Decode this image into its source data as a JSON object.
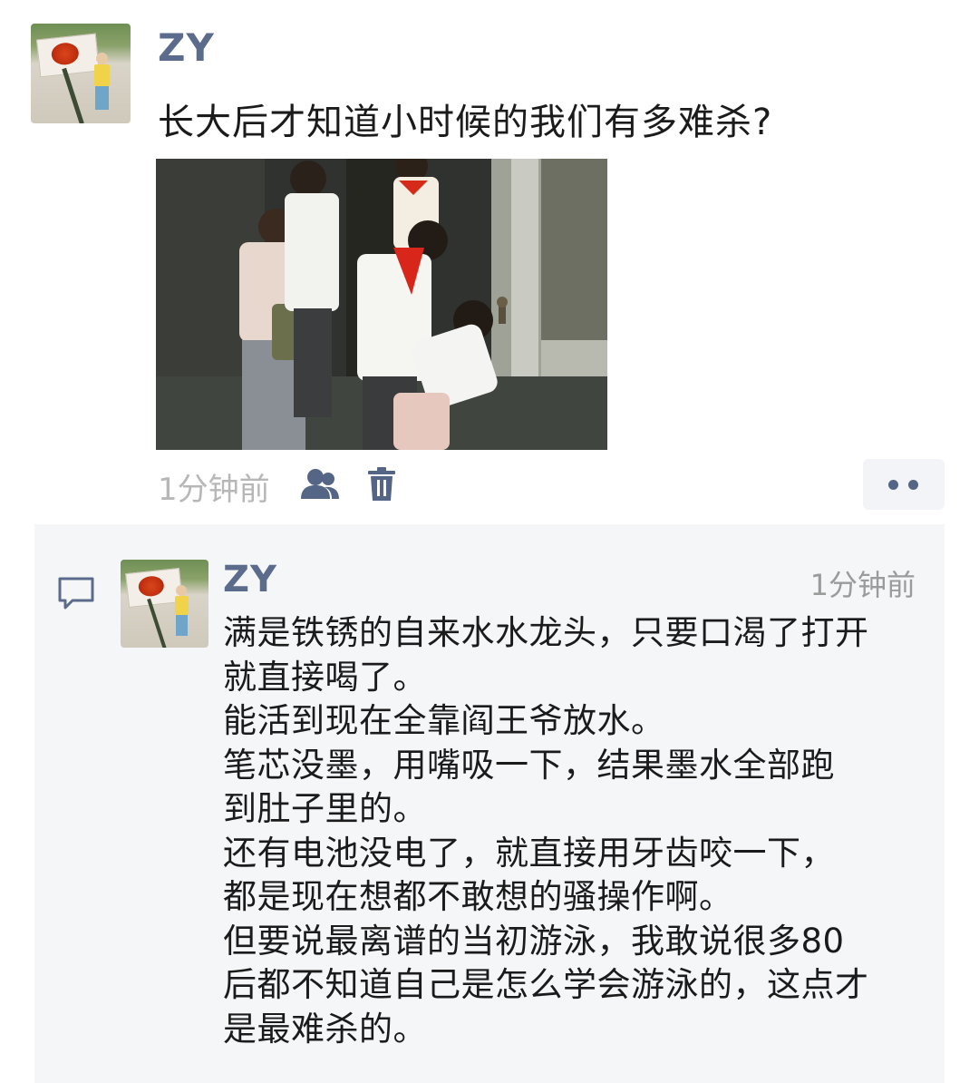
{
  "post": {
    "username": "ZY",
    "text": "长大后才知道小时候的我们有多难杀?",
    "time": "1分钟前",
    "photo_alt": "photo",
    "icons": [
      "people-icon",
      "trash-icon",
      "more-dots-icon"
    ]
  },
  "comment": {
    "username": "ZY",
    "time": "1分钟前",
    "lines": [
      "满是铁锈的自来水水龙头，只要口渴了打开",
      "就直接喝了。",
      "能活到现在全靠阎王爷放水。",
      "笔芯没墨，用嘴吸一下，结果墨水全部跑",
      "到肚子里的。",
      "还有电池没电了，就直接用牙齿咬一下，",
      "都是现在想都不敢想的骚操作啊。",
      "但要说最离谱的当初游泳，我敢说很多80",
      "后都不知道自己是怎么学会游泳的，这点才",
      "是最难杀的。"
    ]
  },
  "colors": {
    "name_blue": "#5b6b8c",
    "meta_gray": "#b7b7b7",
    "comment_bg": "#f5f6f8"
  }
}
